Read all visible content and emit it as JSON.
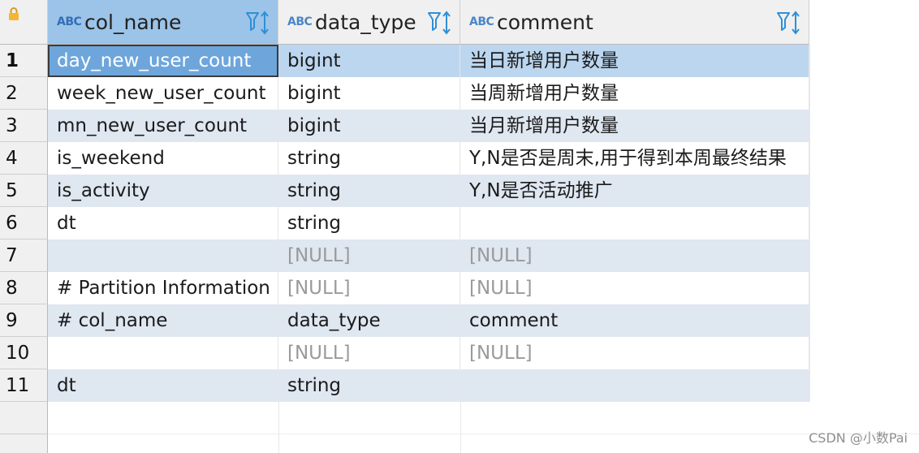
{
  "columns": [
    {
      "type_badge": "ABC",
      "name": "col_name"
    },
    {
      "type_badge": "ABC",
      "name": "data_type"
    },
    {
      "type_badge": "ABC",
      "name": "comment"
    }
  ],
  "rows": [
    {
      "num": "1",
      "col_name": "day_new_user_count",
      "data_type": "bigint",
      "comment": "当日新增用户数量"
    },
    {
      "num": "2",
      "col_name": "week_new_user_count",
      "data_type": "bigint",
      "comment": "当周新增用户数量"
    },
    {
      "num": "3",
      "col_name": "mn_new_user_count",
      "data_type": "bigint",
      "comment": "当月新增用户数量"
    },
    {
      "num": "4",
      "col_name": "is_weekend",
      "data_type": "string",
      "comment": "Y,N是否是周末,用于得到本周最终结果"
    },
    {
      "num": "5",
      "col_name": "is_activity",
      "data_type": "string",
      "comment": "Y,N是否活动推广"
    },
    {
      "num": "6",
      "col_name": "dt",
      "data_type": "string",
      "comment": ""
    },
    {
      "num": "7",
      "col_name": "",
      "data_type": "[NULL]",
      "comment": "[NULL]"
    },
    {
      "num": "8",
      "col_name": "# Partition Information",
      "data_type": "[NULL]",
      "comment": "[NULL]"
    },
    {
      "num": "9",
      "col_name": "# col_name",
      "data_type": "data_type",
      "comment": "comment"
    },
    {
      "num": "10",
      "col_name": "",
      "data_type": "[NULL]",
      "comment": "[NULL]"
    },
    {
      "num": "11",
      "col_name": "dt",
      "data_type": "string",
      "comment": ""
    }
  ],
  "watermark": "CSDN @小数Pai",
  "colors": {
    "selected_header": "#9cc3e8",
    "focused_cell": "#6ea6dc",
    "selected_row": "#bcd6ef",
    "alt_row": "#dfe7f1",
    "null_text": "#9a9a9a",
    "filter_icon": "#2e8fd6"
  },
  "icons": [
    "lock-icon",
    "filter-icon",
    "sort-icon"
  ]
}
